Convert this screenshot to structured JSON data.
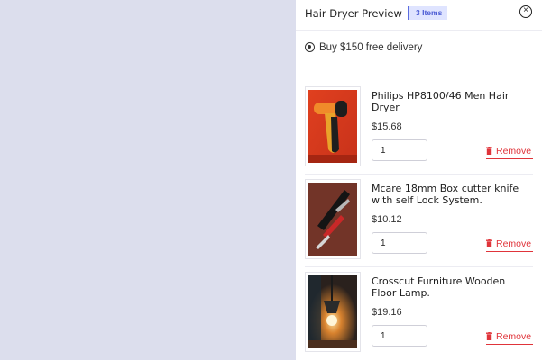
{
  "header": {
    "title": "Hair Dryer Preview",
    "badge": "3 Items",
    "close_icon": "close-circle-icon"
  },
  "delivery": {
    "label": "Buy $150 free delivery",
    "selected": true
  },
  "items": [
    {
      "name": "Philips HP8100/46 Men Hair Dryer",
      "price": "$15.68",
      "quantity": "1",
      "remove_label": "Remove",
      "image_icon": "hair-dryer-image"
    },
    {
      "name": "Mcare 18mm Box cutter knife with self Lock System.",
      "price": "$10.12",
      "quantity": "1",
      "remove_label": "Remove",
      "image_icon": "box-cutter-image"
    },
    {
      "name": "Crosscut Furniture Wooden Floor Lamp.",
      "price": "$19.16",
      "quantity": "1",
      "remove_label": "Remove",
      "image_icon": "floor-lamp-image"
    }
  ],
  "colors": {
    "backdrop": "#dcdeed",
    "accent": "#4b5bd4",
    "badge_bg": "#dfe4ff",
    "remove": "#e0343a"
  }
}
